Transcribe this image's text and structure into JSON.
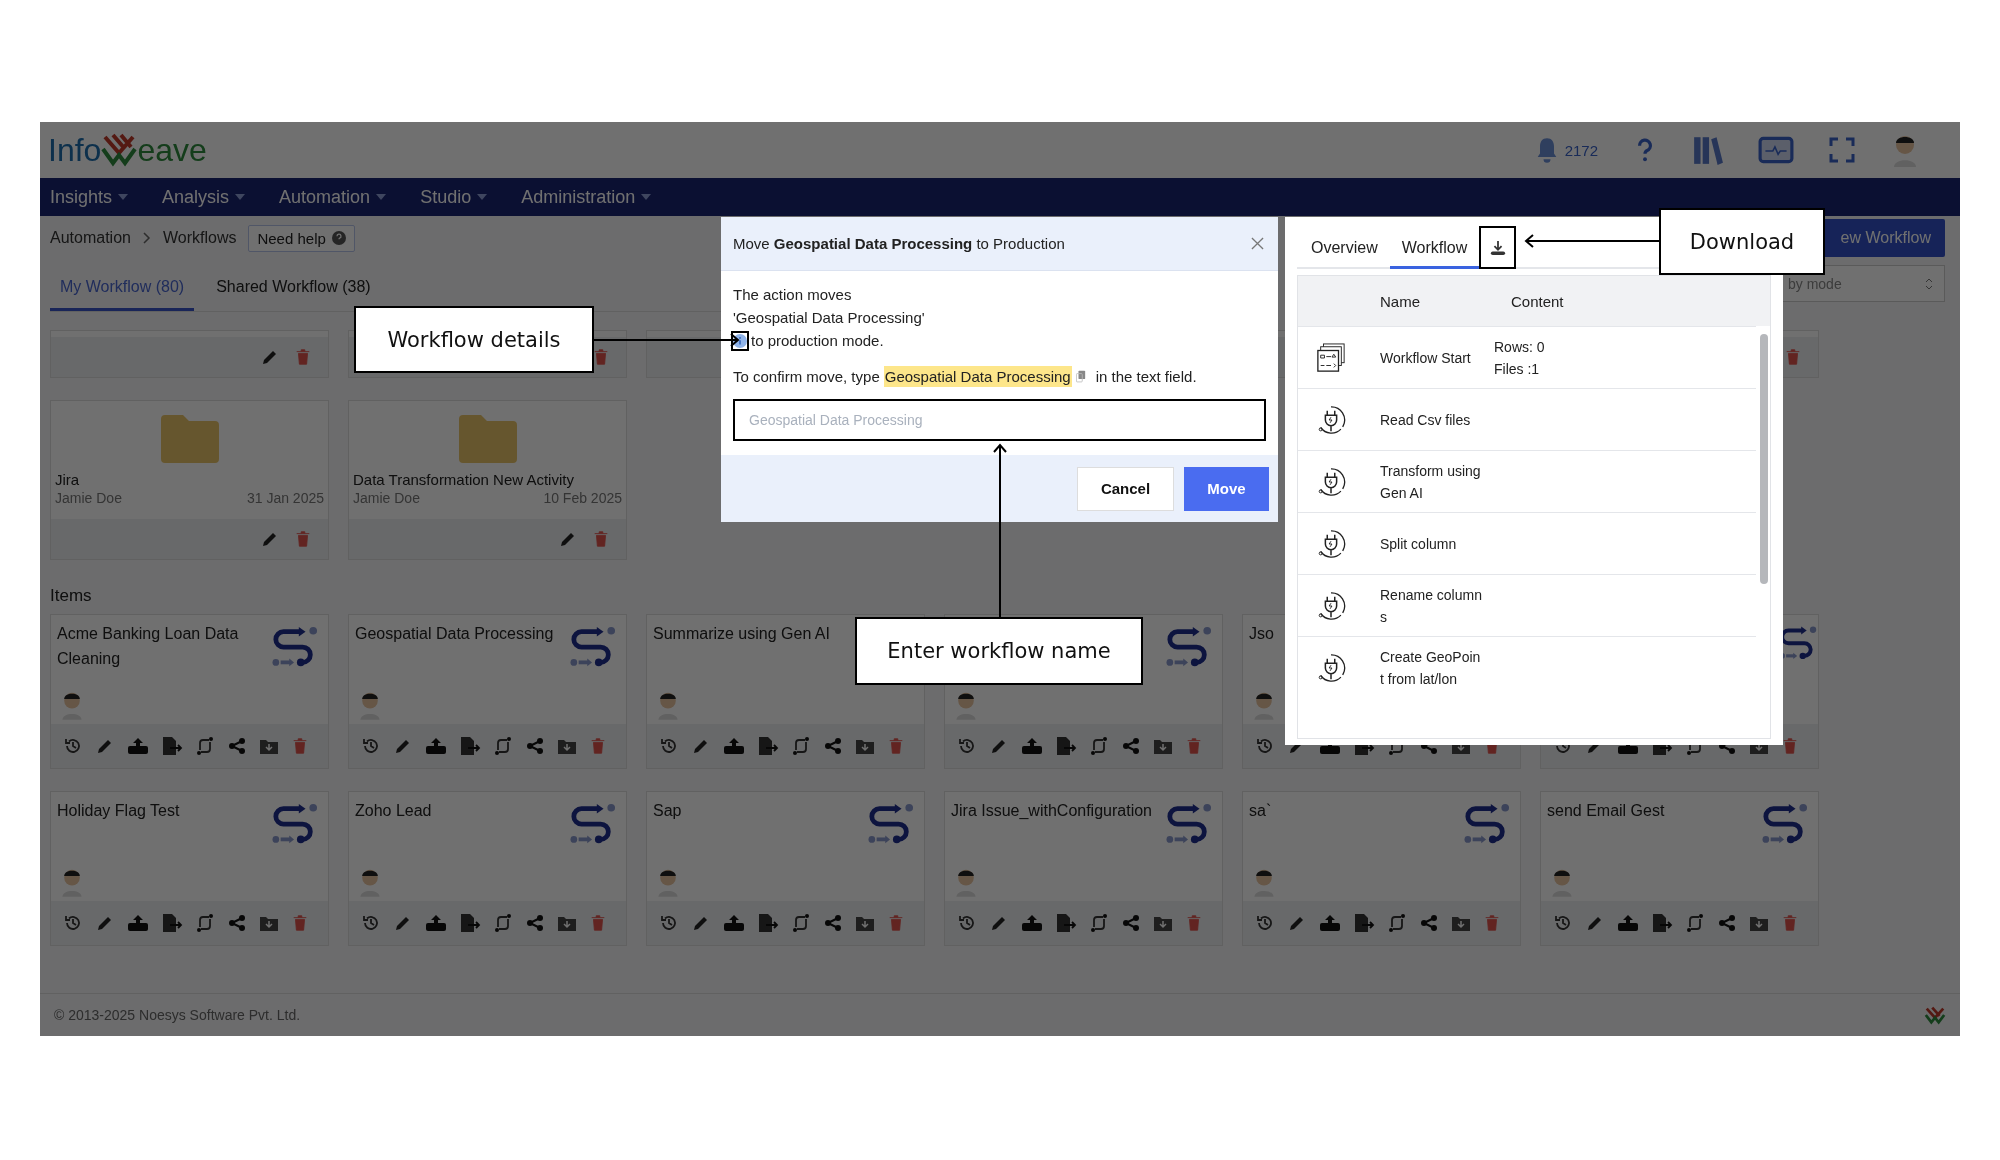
{
  "header": {
    "logo_left": "Info",
    "logo_right": "eave",
    "notification_count": "2172"
  },
  "nav": [
    {
      "label": "Insights"
    },
    {
      "label": "Analysis"
    },
    {
      "label": "Automation"
    },
    {
      "label": "Studio"
    },
    {
      "label": "Administration"
    }
  ],
  "breadcrumb": [
    "Automation",
    "Workflows"
  ],
  "help_button": "Need help",
  "new_workflow_button": "ew Workflow",
  "tabs": [
    {
      "label": "My Workflow (80)",
      "selected": true
    },
    {
      "label": "Shared Workflow (38)",
      "selected": false
    }
  ],
  "mode_select": {
    "placeholder": "by mode"
  },
  "folders": [
    {
      "name": "Jira",
      "owner": "Jamie Doe",
      "date": "31 Jan 2025"
    },
    {
      "name": "Data Transformation New Activity",
      "owner": "Jamie Doe",
      "date": "10 Feb 2025"
    }
  ],
  "items_heading": "Items",
  "items": [
    {
      "kind": "workflow",
      "title": "Acme Banking Loan Data Cleaning"
    },
    {
      "kind": "workflow",
      "title": "Geospatial Data Processing"
    },
    {
      "kind": "workflow",
      "title": "Summarize using Gen AI"
    },
    {
      "kind": "workflow"
    },
    {
      "kind": "workflow",
      "title": "Jso"
    },
    {
      "kind": "workflow"
    },
    {
      "kind": "workflow",
      "title": "Holiday Flag Test"
    },
    {
      "kind": "workflow",
      "title": "Zoho Lead"
    },
    {
      "kind": "workflow",
      "title": "Sap"
    },
    {
      "kind": "workflow",
      "title": "Jira Issue_withConfiguration"
    },
    {
      "kind": "workflow",
      "title": "sa`"
    },
    {
      "kind": "workflow",
      "title": "send Email Gest"
    }
  ],
  "footer": "© 2013-2025 Noesys Software Pvt. Ltd.",
  "dialog": {
    "title": "Move **Geospatial Data Processing** to Production",
    "message_lines": [
      "The action moves",
      "'Geospatial Data Processing'",
      "to production mode."
    ],
    "confirm_prefix": "To confirm move, type",
    "confirm_name": "Geospatial Data Processing",
    "confirm_suffix": "in the text field.",
    "input": {
      "placeholder": "Geospatial Data Processing"
    },
    "buttons": [
      {
        "label": "Cancel",
        "kind": "secondary"
      },
      {
        "label": "Move",
        "kind": "primary"
      }
    ]
  },
  "panel": {
    "tabs": [
      {
        "label": "Overview",
        "selected": false
      },
      {
        "label": "Workflow",
        "selected": true
      }
    ],
    "columns": [
      "Name",
      "Content"
    ],
    "rows": [
      {
        "kind": "start",
        "name": "Workflow Start",
        "content": [
          "Rows: 0",
          "Files :1"
        ]
      },
      {
        "kind": "plugin",
        "name": "Read Csv files"
      },
      {
        "kind": "plugin",
        "name": "Transform using Gen AI"
      },
      {
        "kind": "plugin",
        "name": "Split column"
      },
      {
        "kind": "plugin",
        "name": "Rename columns"
      },
      {
        "kind": "plugin",
        "name": "Create GeoPoint from lat/lon"
      }
    ]
  },
  "callouts": [
    {
      "label": "Workflow details"
    },
    {
      "label": "Enter workflow name"
    },
    {
      "label": "Download"
    }
  ]
}
